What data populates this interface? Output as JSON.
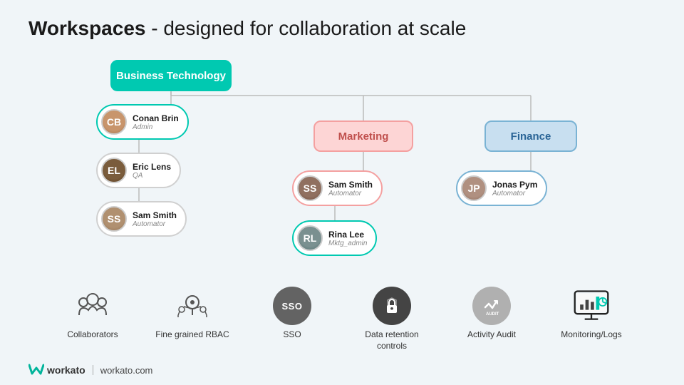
{
  "title": {
    "bold": "Workspaces",
    "rest": " - designed for collaboration at scale"
  },
  "workspaces": {
    "biz_tech": "Business Technology",
    "marketing": "Marketing",
    "finance": "Finance"
  },
  "persons": [
    {
      "id": "conan",
      "name": "Conan Brin",
      "role": "Admin",
      "avatar_class": "face-conan"
    },
    {
      "id": "eric",
      "name": "Eric Lens",
      "role": "QA",
      "avatar_class": "face-eric"
    },
    {
      "id": "sam-biz",
      "name": "Sam Smith",
      "role": "Automator",
      "avatar_class": "face-sam"
    },
    {
      "id": "sam-mkt",
      "name": "Sam Smith",
      "role": "Automator",
      "avatar_class": "face-samm"
    },
    {
      "id": "rina",
      "name": "Rina Lee",
      "role": "Mktg_admin",
      "avatar_class": "face-rina"
    },
    {
      "id": "jonas",
      "name": "Jonas Pym",
      "role": "Automator",
      "avatar_class": "face-jonas"
    }
  ],
  "features": [
    {
      "id": "collaborators",
      "label": "Collaborators",
      "icon_type": "people"
    },
    {
      "id": "rbac",
      "label": "Fine grained RBAC",
      "icon_type": "key"
    },
    {
      "id": "sso",
      "label": "SSO",
      "icon_type": "sso"
    },
    {
      "id": "data-retention",
      "label": "Data retention controls",
      "icon_type": "lock"
    },
    {
      "id": "activity-audit",
      "label": "Activity Audit",
      "icon_type": "audit"
    },
    {
      "id": "monitoring",
      "label": "Monitoring/Logs",
      "icon_type": "monitor"
    }
  ],
  "footer": {
    "brand": "workato",
    "url": "workato.com"
  }
}
